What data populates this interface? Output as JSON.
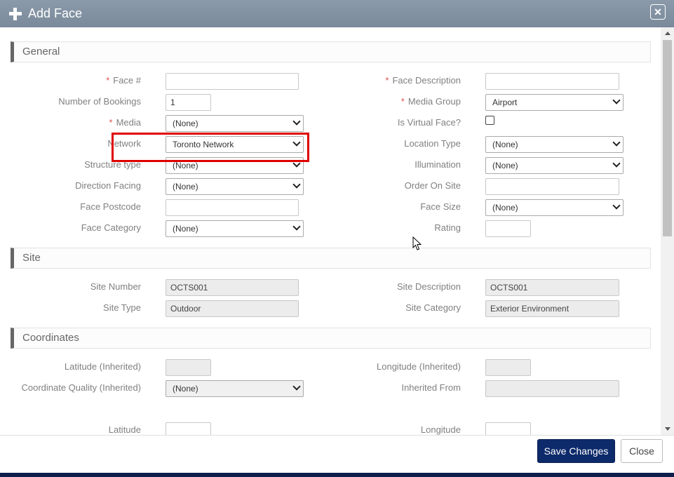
{
  "dialog": {
    "title": "Add Face"
  },
  "sections": {
    "general": "General",
    "site": "Site",
    "coordinates": "Coordinates"
  },
  "general": {
    "face_number": {
      "label": "Face #",
      "value": ""
    },
    "face_description": {
      "label": "Face Description",
      "value": ""
    },
    "number_of_bookings": {
      "label": "Number of Bookings",
      "value": "1"
    },
    "media_group": {
      "label": "Media Group",
      "value": "Airport"
    },
    "media": {
      "label": "Media",
      "value": "(None)"
    },
    "is_virtual_face": {
      "label": "Is Virtual Face?"
    },
    "network": {
      "label": "Network",
      "value": "Toronto Network"
    },
    "location_type": {
      "label": "Location Type",
      "value": "(None)"
    },
    "structure_type": {
      "label": "Structure type",
      "value": "(None)"
    },
    "illumination": {
      "label": "Illumination",
      "value": "(None)"
    },
    "direction_facing": {
      "label": "Direction Facing",
      "value": "(None)"
    },
    "order_on_site": {
      "label": "Order On Site",
      "value": ""
    },
    "face_postcode": {
      "label": "Face Postcode",
      "value": ""
    },
    "face_size": {
      "label": "Face Size",
      "value": "(None)"
    },
    "face_category": {
      "label": "Face Category",
      "value": "(None)"
    },
    "rating": {
      "label": "Rating",
      "value": ""
    }
  },
  "site": {
    "site_number": {
      "label": "Site Number",
      "value": "OCTS001"
    },
    "site_description": {
      "label": "Site Description",
      "value": "OCTS001"
    },
    "site_type": {
      "label": "Site Type",
      "value": "Outdoor"
    },
    "site_category": {
      "label": "Site Category",
      "value": "Exterior Environment"
    }
  },
  "coordinates": {
    "latitude_inherited": {
      "label": "Latitude (Inherited)",
      "value": ""
    },
    "longitude_inherited": {
      "label": "Longitude (Inherited)",
      "value": ""
    },
    "coordinate_quality": {
      "label": "Coordinate Quality (Inherited)",
      "value": "(None)"
    },
    "inherited_from": {
      "label": "Inherited From",
      "value": ""
    },
    "latitude": {
      "label": "Latitude",
      "value": ""
    },
    "longitude": {
      "label": "Longitude",
      "value": ""
    }
  },
  "footer": {
    "save_label": "Save Changes",
    "close_label": "Close"
  },
  "colors": {
    "required": "#e05050",
    "highlight": "#e00000",
    "primary_button": "#0d2a6a",
    "titlebar": "#7f8fa0"
  },
  "icons": {
    "title": "plus-icon",
    "close": "close-icon"
  }
}
